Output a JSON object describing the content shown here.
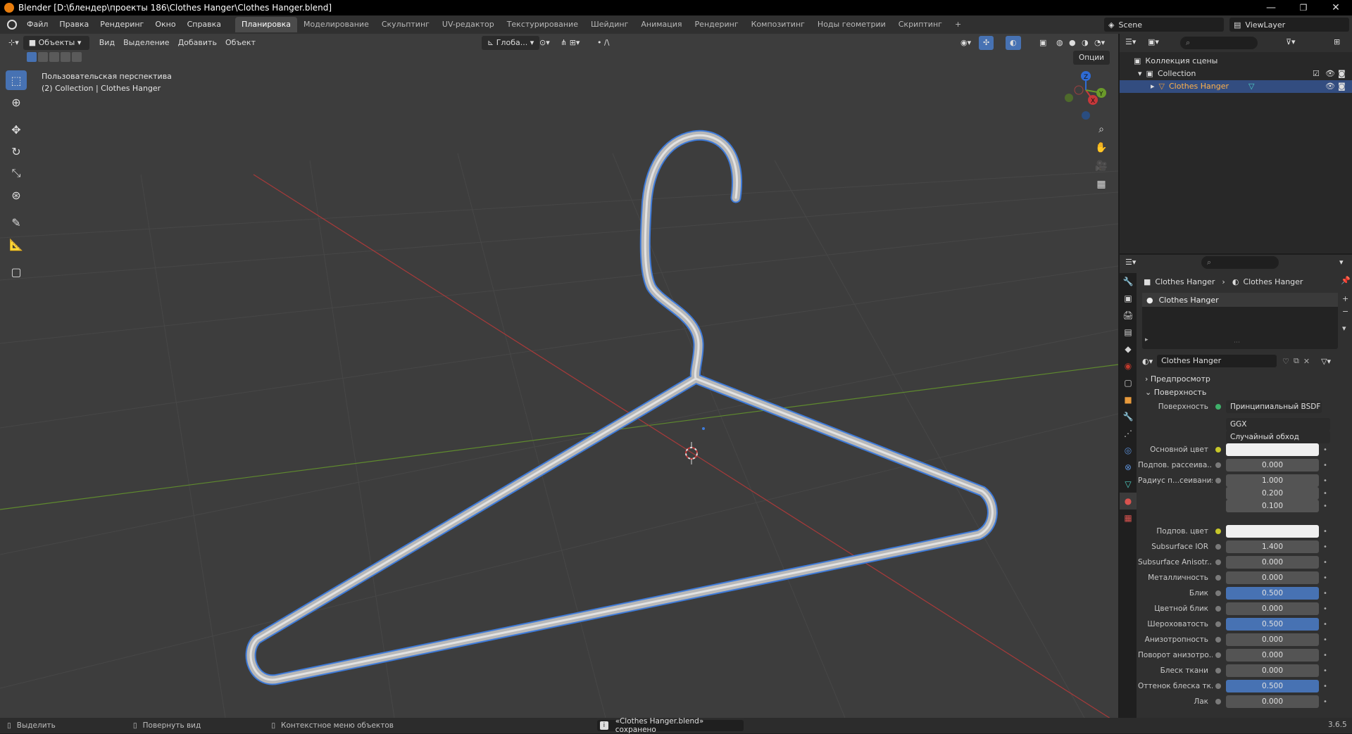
{
  "window": {
    "title": "Blender [D:\\блендер\\проекты 186\\Clothes Hanger\\Clothes Hanger.blend]",
    "minimize": "—",
    "maximize": "❐",
    "close": "✕"
  },
  "menu": {
    "items": [
      "Файл",
      "Правка",
      "Рендеринг",
      "Окно",
      "Справка"
    ],
    "workspaces": [
      "Планировка",
      "Моделирование",
      "Скульптинг",
      "UV-редактор",
      "Текстурирование",
      "Шейдинг",
      "Анимация",
      "Рендеринг",
      "Композитинг",
      "Ноды геометрии",
      "Скриптинг"
    ],
    "active_workspace": 0,
    "add_tab": "+",
    "scene": "Scene",
    "view_layer": "ViewLayer"
  },
  "viewport": {
    "mode": "Объекты",
    "menus": [
      "Вид",
      "Выделение",
      "Добавить",
      "Объект"
    ],
    "orientation": "Глоба...",
    "options": "Опции",
    "perspective_label": "Пользовательская перспектива",
    "collection_label": "(2) Collection | Clothes Hanger",
    "gizmo": {
      "x": "X",
      "y": "Y",
      "z": "Z"
    }
  },
  "outliner": {
    "search_placeholder": "",
    "scene_collection": "Коллекция сцены",
    "collection": "Collection",
    "object": "Clothes Hanger"
  },
  "properties": {
    "breadcrumb_object": "Clothes Hanger",
    "breadcrumb_material": "Clothes Hanger",
    "slot": "Clothes Hanger",
    "material_name": "Clothes Hanger",
    "sections": {
      "preview": "Предпросмотр",
      "surface": "Поверхность"
    },
    "surface_label": "Поверхность",
    "surface_value": "Принципиальный BSDF",
    "distribution": "GGX",
    "subsurface_method": "Случайный обход",
    "rows": [
      {
        "label": "Основной цвет",
        "value": "",
        "style": "white",
        "dot": "y"
      },
      {
        "label": "Подпов. рассеива...",
        "value": "0.000",
        "style": "",
        "dot": ""
      },
      {
        "label": "Радиус п...сеивания",
        "value": "1.000",
        "style": "",
        "dot": ""
      },
      {
        "label": "",
        "value": "0.200",
        "style": "",
        "dot": "none"
      },
      {
        "label": "",
        "value": "0.100",
        "style": "",
        "dot": "none"
      },
      {
        "label": "Подпов. цвет",
        "value": "",
        "style": "white",
        "dot": "y"
      },
      {
        "label": "Subsurface IOR",
        "value": "1.400",
        "style": "",
        "dot": ""
      },
      {
        "label": "Subsurface Anisotr...",
        "value": "0.000",
        "style": "",
        "dot": ""
      },
      {
        "label": "Металличность",
        "value": "0.000",
        "style": "",
        "dot": ""
      },
      {
        "label": "Блик",
        "value": "0.500",
        "style": "blue",
        "dot": ""
      },
      {
        "label": "Цветной блик",
        "value": "0.000",
        "style": "",
        "dot": ""
      },
      {
        "label": "Шероховатость",
        "value": "0.500",
        "style": "blue",
        "dot": ""
      },
      {
        "label": "Анизотропность",
        "value": "0.000",
        "style": "",
        "dot": ""
      },
      {
        "label": "Поворот анизотро...",
        "value": "0.000",
        "style": "",
        "dot": ""
      },
      {
        "label": "Блеск ткани",
        "value": "0.000",
        "style": "",
        "dot": ""
      },
      {
        "label": "Оттенок блеска тк...",
        "value": "0.500",
        "style": "blue",
        "dot": ""
      },
      {
        "label": "Лак",
        "value": "0.000",
        "style": "",
        "dot": ""
      }
    ]
  },
  "statusbar": {
    "select": "Выделить",
    "rotate": "Повернуть вид",
    "context": "Контекстное меню объектов",
    "message": "«Clothes Hanger.blend» сохранено",
    "version": "3.6.5"
  },
  "colors": {
    "accent": "#4772b3",
    "selection_outline": "#3f7bd9",
    "x_axis": "#c0393b",
    "y_axis": "#6a9a2a"
  }
}
